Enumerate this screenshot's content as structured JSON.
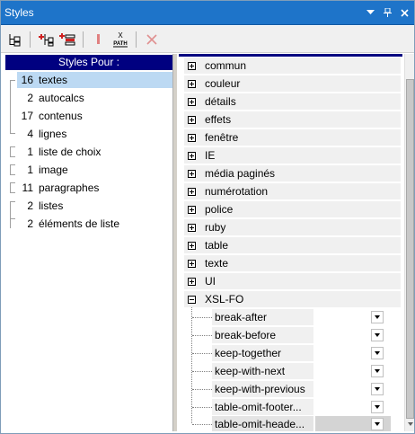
{
  "window": {
    "title": "Styles",
    "controls": [
      "dropdown-arrow",
      "pin",
      "close"
    ]
  },
  "toolbar": {
    "tools": [
      {
        "name": "tree-view-icon"
      },
      {
        "name": "add-style-icon"
      },
      {
        "name": "add-child-style-icon"
      },
      {
        "name": "important-icon"
      },
      {
        "name": "xpath-icon",
        "label": "PATH"
      },
      {
        "name": "delete-icon"
      }
    ],
    "xpath_label": "PATH"
  },
  "left": {
    "header": "Styles Pour :",
    "items": [
      {
        "count": "16",
        "label": "textes"
      },
      {
        "count": "2",
        "label": "autocalcs"
      },
      {
        "count": "17",
        "label": "contenus"
      },
      {
        "count": "4",
        "label": "lignes"
      },
      {
        "count": "1",
        "label": "liste de choix"
      },
      {
        "count": "1",
        "label": "image"
      },
      {
        "count": "11",
        "label": "paragraphes"
      },
      {
        "count": "2",
        "label": "listes"
      },
      {
        "count": "2",
        "label": "éléments de liste"
      }
    ]
  },
  "right": {
    "categories": [
      {
        "label": "commun",
        "expanded": false
      },
      {
        "label": "couleur",
        "expanded": false
      },
      {
        "label": "détails",
        "expanded": false
      },
      {
        "label": "effets",
        "expanded": false
      },
      {
        "label": "fenêtre",
        "expanded": false
      },
      {
        "label": "IE",
        "expanded": false
      },
      {
        "label": "média paginés",
        "expanded": false
      },
      {
        "label": "numérotation",
        "expanded": false
      },
      {
        "label": "police",
        "expanded": false
      },
      {
        "label": "ruby",
        "expanded": false
      },
      {
        "label": "table",
        "expanded": false
      },
      {
        "label": "texte",
        "expanded": false
      },
      {
        "label": "UI",
        "expanded": false
      },
      {
        "label": "XSL-FO",
        "expanded": true
      }
    ],
    "properties": [
      {
        "label": "break-after",
        "value": ""
      },
      {
        "label": "break-before",
        "value": ""
      },
      {
        "label": "keep-together",
        "value": ""
      },
      {
        "label": "keep-with-next",
        "value": ""
      },
      {
        "label": "keep-with-previous",
        "value": ""
      },
      {
        "label": "table-omit-footer...",
        "value": ""
      },
      {
        "label": "table-omit-heade...",
        "value": ""
      }
    ]
  }
}
